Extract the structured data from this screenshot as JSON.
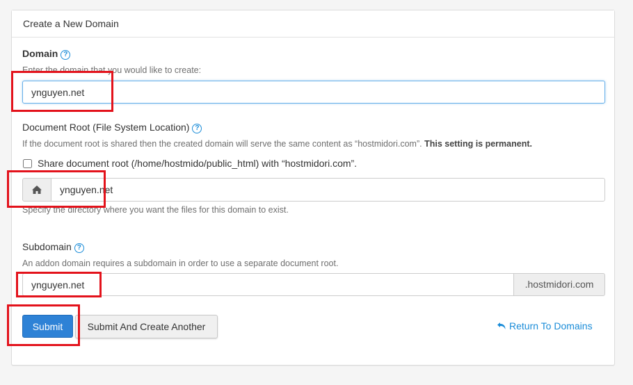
{
  "panel": {
    "title": "Create a New Domain"
  },
  "domain": {
    "label": "Domain",
    "help_icon": "?",
    "hint": "Enter the domain that you would like to create:",
    "value": "ynguyen.net"
  },
  "docroot": {
    "label": "Document Root (File System Location)",
    "help_icon": "?",
    "description": "If the document root is shared then the created domain will serve the same content as “hostmidori.com”.",
    "description_bold": "This setting is permanent.",
    "share_checkbox_label": "Share document root (/home/hostmido/public_html) with “hostmidori.com”.",
    "share_checked": false,
    "home_icon": "home-icon",
    "value": "ynguyen.net",
    "hint": "Specify the directory where you want the files for this domain to exist."
  },
  "subdomain": {
    "label": "Subdomain",
    "help_icon": "?",
    "hint": "An addon domain requires a subdomain in order to use a separate document root.",
    "value": "ynguyen.net",
    "suffix": ".hostmidori.com"
  },
  "actions": {
    "submit_label": "Submit",
    "submit_another_label": "Submit And Create Another",
    "return_label": "Return To Domains",
    "return_icon": "undo-arrow-icon"
  },
  "colors": {
    "primary": "#2e82d6",
    "link": "#1a8cd8",
    "highlight": "#e3121b"
  }
}
